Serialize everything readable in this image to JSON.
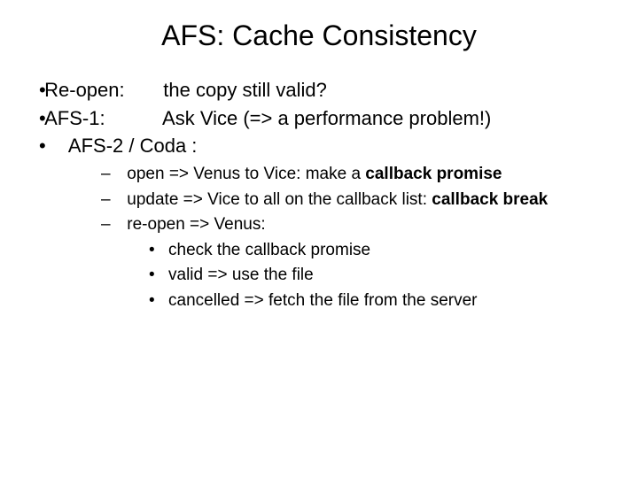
{
  "title": "AFS: Cache Consistency",
  "bullets": {
    "b1_key": "Re-open:",
    "b1_val": "the copy still valid?",
    "b2_key": "AFS-1:",
    "b2_val": "Ask Vice (=> a performance problem!)",
    "b3": "AFS-2 / Coda :",
    "s1_pre": "open => Venus to Vice: make a ",
    "s1_bold": "callback promise",
    "s2_pre": "update =>  Vice to all on the callback list: ",
    "s2_bold": "callback break",
    "s3": "re-open => Venus:",
    "t1": "check the callback promise",
    "t2": "valid => use the file",
    "t3": "cancelled => fetch the file from the server"
  }
}
